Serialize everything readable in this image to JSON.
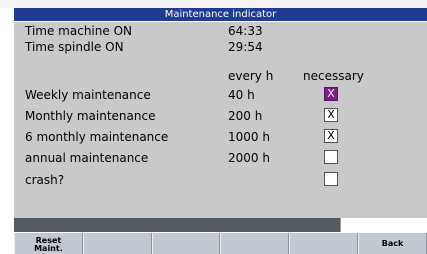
{
  "window": {
    "title": "Maintenance indicator"
  },
  "machine_info": [
    {
      "label": "Time machine ON",
      "value": "64:33"
    },
    {
      "label": "Time spindle ON",
      "value": "29:54"
    }
  ],
  "table_headers": {
    "interval": "every h",
    "necessary": "necessary"
  },
  "maintenance_items": [
    {
      "label": "Weekly maintenance",
      "interval": "40 h",
      "check": "X",
      "state": "active"
    },
    {
      "label": "Monthly maintenance",
      "interval": "200 h",
      "check": "X",
      "state": "checked"
    },
    {
      "label": "6 monthly maintenance",
      "interval": "1000 h",
      "check": "X",
      "state": "checked"
    },
    {
      "label": "annual maintenance",
      "interval": "2000 h",
      "check": "",
      "state": "empty"
    },
    {
      "label": "crash?",
      "interval": "",
      "check": "",
      "state": "empty"
    }
  ],
  "softkeys": [
    "Reset\nMaint.",
    "",
    "",
    "",
    "",
    "Back"
  ],
  "colors": {
    "title_bar": "#1f3b92",
    "panel": "#c9c9c9",
    "checkbox_active": "#7a1f86"
  }
}
